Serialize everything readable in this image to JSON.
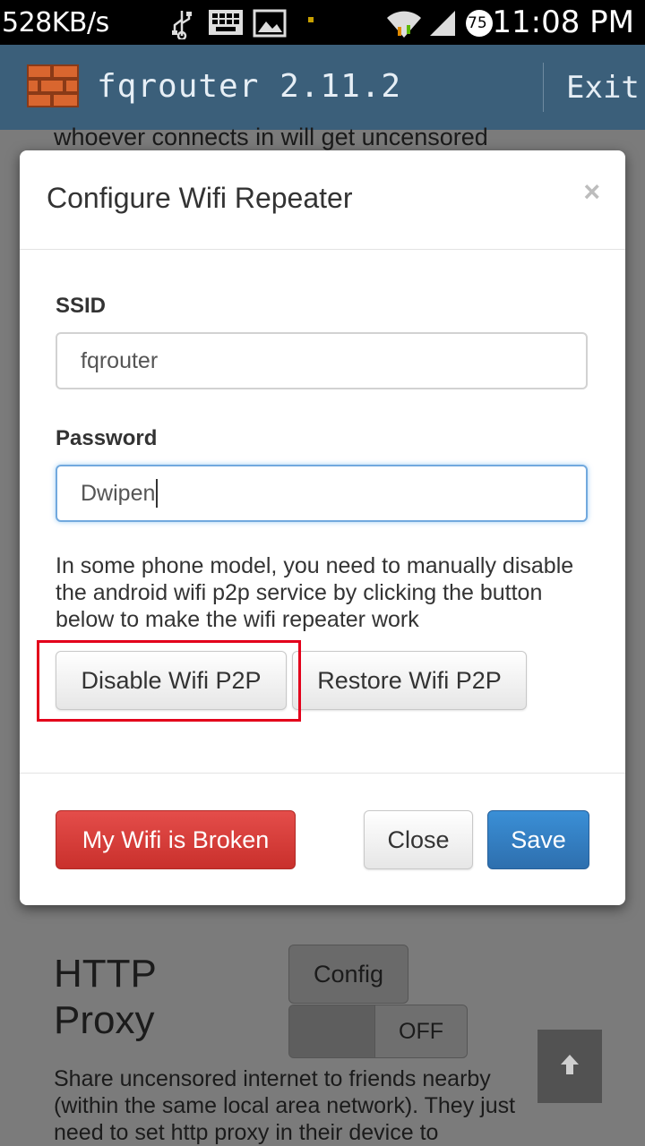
{
  "status_bar": {
    "speed": "528KB/s",
    "battery": "75",
    "time": "11:08 PM",
    "icons": [
      "usb-icon",
      "keyboard-icon",
      "image-icon",
      "notification-dot-icon",
      "wifi-icon",
      "signal-icon",
      "battery-icon"
    ]
  },
  "app_bar": {
    "title": "fqrouter 2.11.2",
    "exit_label": "Exit",
    "logo_icon": "brick-wall-icon",
    "bar_color": "#3b5f7a"
  },
  "background": {
    "top_text": "whoever connects in will get uncensored",
    "section_title": "HTTP Proxy",
    "config_label": "Config",
    "toggle_label": "OFF",
    "description": "Share uncensored internet to friends nearby (within the same local area network). They just need to set http proxy in their device to"
  },
  "modal": {
    "title": "Configure Wifi Repeater",
    "close_symbol": "×",
    "ssid_label": "SSID",
    "ssid_value": "fqrouter",
    "password_label": "Password",
    "password_value": "Dwipen",
    "help_text": "In some phone model, you need to manually disable the android wifi p2p service by clicking the button below to make the wifi repeater work",
    "disable_p2p_label": "Disable Wifi P2P",
    "restore_p2p_label": "Restore Wifi P2P",
    "broken_label": "My Wifi is Broken",
    "close_label": "Close",
    "save_label": "Save"
  },
  "colors": {
    "danger": "#d9534f",
    "primary": "#3276b1",
    "highlight": "#e3001b"
  }
}
